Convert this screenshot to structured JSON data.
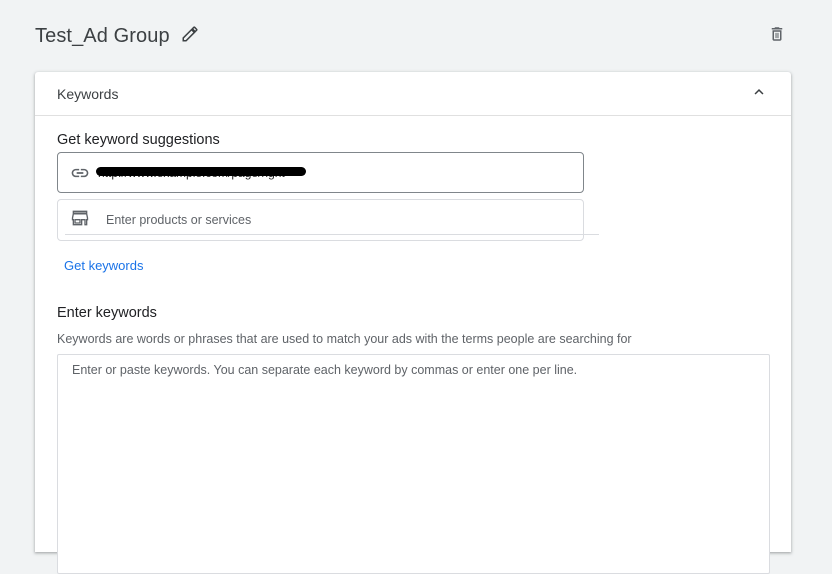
{
  "header": {
    "ad_group_name": "Test_Ad Group",
    "edit_icon": "pencil-icon",
    "delete_icon": "trash-icon"
  },
  "keywords_card": {
    "title": "Keywords",
    "collapse_icon": "chevron-up-icon",
    "suggestions": {
      "label": "Get keyword suggestions",
      "url_icon": "link-icon",
      "url_value": "http://www.example.com/page/right",
      "products_icon": "store-icon",
      "products_placeholder": "Enter products or services",
      "get_keywords_label": "Get keywords"
    },
    "enter_keywords": {
      "label": "Enter keywords",
      "helper": "Keywords are words or phrases that are used to match your ads with the terms people are searching for",
      "placeholder": "Enter or paste keywords. You can separate each keyword by commas or enter one per line."
    }
  },
  "colors": {
    "link": "#1a73e8",
    "page_background": "#f1f3f4",
    "card_background": "#ffffff",
    "icon": "#5f6368"
  }
}
